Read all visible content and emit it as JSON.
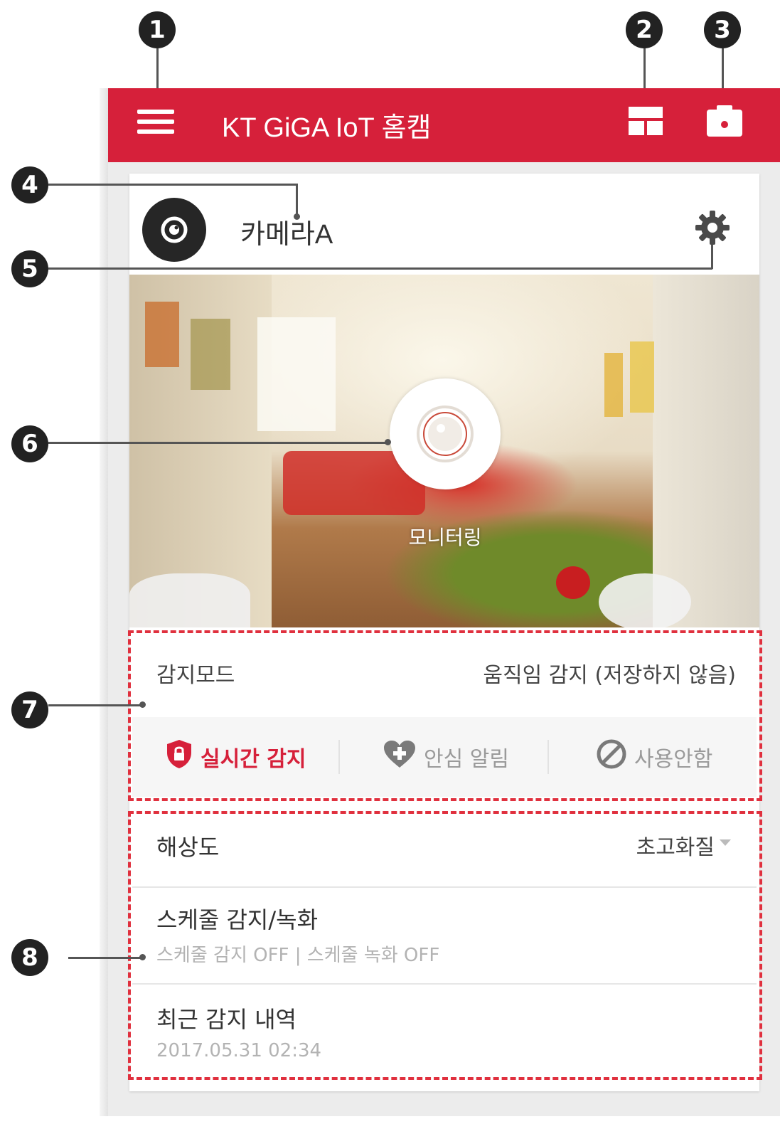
{
  "callouts": [
    "1",
    "2",
    "3",
    "4",
    "5",
    "6",
    "7",
    "8"
  ],
  "appbar": {
    "title": "KT GiGA IoT 홈캠",
    "background": "#d6203a",
    "menu_icon": "hamburger-icon",
    "grid_icon": "grid-view-icon",
    "photo_icon": "photo-album-icon"
  },
  "camera": {
    "name": "카메라A",
    "avatar_icon": "camera-lens-icon",
    "settings_icon": "gear-icon"
  },
  "preview": {
    "monitor_label": "모니터링",
    "monitor_icon": "camera-lens-icon"
  },
  "detection": {
    "mode_label": "감지모드",
    "mode_value": "움직임 감지 (저장하지 않음)",
    "options": [
      {
        "label": "실시간 감지",
        "icon": "shield-lock-icon",
        "selected": true,
        "color": "#d6203a"
      },
      {
        "label": "안심 알림",
        "icon": "heart-plus-icon",
        "selected": false,
        "color": "#9a9a9a"
      },
      {
        "label": "사용안함",
        "icon": "prohibited-icon",
        "selected": false,
        "color": "#9a9a9a"
      }
    ]
  },
  "settings": {
    "resolution_label": "해상도",
    "resolution_value": "초고화질",
    "schedule_label": "스케줄 감지/녹화",
    "schedule_status": "스케줄 감지 OFF | 스케줄 녹화 OFF",
    "recent_label": "최근 감지 내역",
    "recent_time": "2017.05.31 02:34"
  },
  "accent_colors": {
    "highlight_dash": "#e0303e",
    "brand_red": "#d6203a"
  }
}
